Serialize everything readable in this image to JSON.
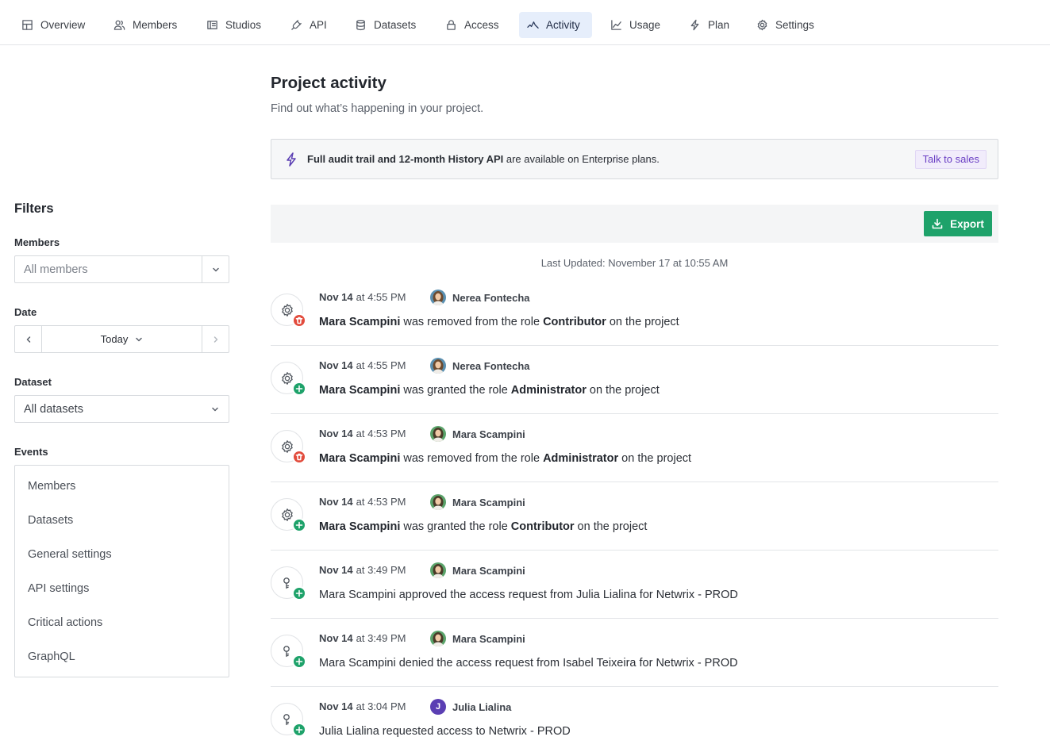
{
  "nav": {
    "tabs": [
      {
        "label": "Overview",
        "icon": "layout-icon"
      },
      {
        "label": "Members",
        "icon": "users-icon"
      },
      {
        "label": "Studios",
        "icon": "studio-icon"
      },
      {
        "label": "API",
        "icon": "plug-icon"
      },
      {
        "label": "Datasets",
        "icon": "database-icon"
      },
      {
        "label": "Access",
        "icon": "lock-icon"
      },
      {
        "label": "Activity",
        "icon": "activity-icon",
        "active": true
      },
      {
        "label": "Usage",
        "icon": "chart-icon"
      },
      {
        "label": "Plan",
        "icon": "bolt-icon"
      },
      {
        "label": "Settings",
        "icon": "gear-icon"
      }
    ]
  },
  "filters": {
    "title": "Filters",
    "members_label": "Members",
    "members_placeholder": "All members",
    "date_label": "Date",
    "date_value": "Today",
    "dataset_label": "Dataset",
    "dataset_value": "All datasets",
    "events_label": "Events",
    "events": [
      "Members",
      "Datasets",
      "General settings",
      "API settings",
      "Critical actions",
      "GraphQL"
    ]
  },
  "main": {
    "title": "Project activity",
    "subtitle": "Find out what’s happening in your project.",
    "banner": {
      "bold": "Full audit trail and 12-month History API",
      "rest": " are available on Enterprise plans.",
      "cta": "Talk to sales"
    },
    "export_label": "Export",
    "last_updated": "Last Updated: November 17 at 10:55 AM"
  },
  "colors": {
    "accent_green": "#1ea26a",
    "danger_red": "#e24b3c",
    "purple": "#5b3fb3",
    "active_tab_bg": "#e6eefb"
  },
  "activity": [
    {
      "date": "Nov 14",
      "time": "at 4:55 PM",
      "actor": "Nerea Fontecha",
      "icon": "gear-icon",
      "badge": "trash-icon",
      "parts": [
        {
          "t": "Mara Scampini",
          "b": true
        },
        {
          "t": " was removed from the role ",
          "b": false
        },
        {
          "t": "Contributor",
          "b": true
        },
        {
          "t": " on the project",
          "b": false
        }
      ]
    },
    {
      "date": "Nov 14",
      "time": "at 4:55 PM",
      "actor": "Nerea Fontecha",
      "icon": "gear-icon",
      "badge": "plus-icon",
      "parts": [
        {
          "t": "Mara Scampini",
          "b": true
        },
        {
          "t": " was granted the role ",
          "b": false
        },
        {
          "t": "Administrator",
          "b": true
        },
        {
          "t": " on the project",
          "b": false
        }
      ]
    },
    {
      "date": "Nov 14",
      "time": "at 4:53 PM",
      "actor": "Mara Scampini",
      "icon": "gear-icon",
      "badge": "trash-icon",
      "parts": [
        {
          "t": "Mara Scampini",
          "b": true
        },
        {
          "t": " was removed from the role ",
          "b": false
        },
        {
          "t": "Administrator",
          "b": true
        },
        {
          "t": " on the project",
          "b": false
        }
      ]
    },
    {
      "date": "Nov 14",
      "time": "at 4:53 PM",
      "actor": "Mara Scampini",
      "icon": "gear-icon",
      "badge": "plus-icon",
      "parts": [
        {
          "t": "Mara Scampini",
          "b": true
        },
        {
          "t": " was granted the role ",
          "b": false
        },
        {
          "t": "Contributor",
          "b": true
        },
        {
          "t": " on the project",
          "b": false
        }
      ]
    },
    {
      "date": "Nov 14",
      "time": "at 3:49 PM",
      "actor": "Mara Scampini",
      "icon": "access-icon",
      "badge": "plus-icon",
      "parts": [
        {
          "t": "Mara Scampini approved the access request from Julia Lialina for Netwrix - PROD",
          "b": false
        }
      ]
    },
    {
      "date": "Nov 14",
      "time": "at 3:49 PM",
      "actor": "Mara Scampini",
      "icon": "access-icon",
      "badge": "plus-icon",
      "parts": [
        {
          "t": "Mara Scampini denied the access request from Isabel Teixeira for Netwrix - PROD",
          "b": false
        }
      ]
    },
    {
      "date": "Nov 14",
      "time": "at 3:04 PM",
      "actor": "Julia Lialina",
      "avatar_letter": "J",
      "icon": "access-icon",
      "badge": "plus-icon",
      "parts": [
        {
          "t": "Julia Lialina requested access to Netwrix - PROD",
          "b": false
        }
      ]
    }
  ]
}
